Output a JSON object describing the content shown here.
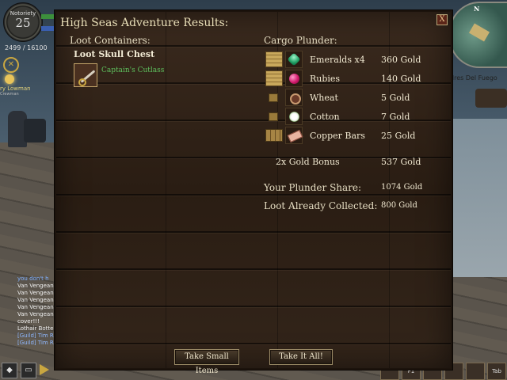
{
  "hud": {
    "notoriety_label": "Notoriety",
    "notoriety_level": "25",
    "xp": "2499 / 16100",
    "nameplate_name": "ry Lowman",
    "nameplate_sub": "Crewman",
    "location": "dres Del Fuego",
    "minimap_north": "N"
  },
  "chat": [
    {
      "text": "you don't h",
      "style": "c-blue"
    },
    {
      "text": "Van Vengean",
      "style": "c-white"
    },
    {
      "text": "Van Vengean",
      "style": "c-white"
    },
    {
      "text": "Van Vengean",
      "style": "c-white"
    },
    {
      "text": "Van Vengean",
      "style": "c-white"
    },
    {
      "text": "Van Vengean",
      "style": "c-white"
    },
    {
      "text": "cover!!!",
      "style": "c-white"
    },
    {
      "text": "Lothair Botter",
      "style": "c-white"
    },
    {
      "text": "[Guild] Tim Ri",
      "style": "c-guild"
    },
    {
      "text": "[Guild] Tim Ri",
      "style": "c-guild"
    }
  ],
  "hotbar": {
    "slot_f1": "F1",
    "slot_tab": "Tab"
  },
  "dialog": {
    "title": "High Seas Adventure Results:",
    "close_glyph": "X",
    "loot_header": "Loot Containers:",
    "chest_name": "Loot Skull Chest",
    "chest_item": "Captain's Cutlass",
    "cargo_header": "Cargo Plunder:",
    "cargo": [
      {
        "crate": "big",
        "icon": "emerald",
        "name": "Emeralds x4",
        "value": "360 Gold"
      },
      {
        "crate": "big",
        "icon": "ruby",
        "name": "Rubies",
        "value": "140 Gold"
      },
      {
        "crate": "small",
        "icon": "wheat",
        "name": "Wheat",
        "value": "5 Gold"
      },
      {
        "crate": "small",
        "icon": "cotton",
        "name": "Cotton",
        "value": "7 Gold"
      },
      {
        "crate": "mid",
        "icon": "copper",
        "name": "Copper Bars",
        "value": "25 Gold"
      }
    ],
    "bonus_label": "2x Gold Bonus",
    "bonus_value": "537 Gold",
    "share_label": "Your Plunder Share:",
    "share_value": "1074 Gold",
    "collected_label": "Loot Already Collected:",
    "collected_value": "800 Gold",
    "btn_small": "Take Small Items",
    "btn_all": "Take It All!"
  }
}
